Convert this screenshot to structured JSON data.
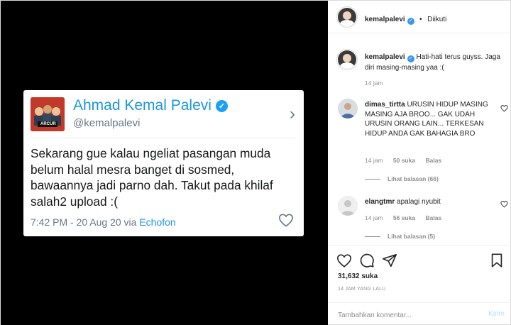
{
  "tweet": {
    "display_name": "Ahmad Kemal Palevi",
    "handle": "@kemalpalevi",
    "avatar_text": "ARCUR",
    "text": "Sekarang gue kalau ngeliat pasangan muda belum halal mesra banget di sosmed, bawaannya jadi parno dah. Takut pada khilaf salah2 upload :(",
    "time": "7:42 PM - 20 Aug 20 via",
    "source": "Echofon"
  },
  "header": {
    "username": "kemalpalevi",
    "separator": "•",
    "follow_status": "Diikuti"
  },
  "caption": {
    "username": "kemalpalevi",
    "text": "Hati-hati terus guyss. Jaga diri masing-masing yaa :(",
    "time": "14 jam"
  },
  "comments": [
    {
      "username": "dimas_tirtta",
      "text": "URUSIN HIDUP MASING MASING AJA BROO... GAK UDAH URUSIN ORANG LAIN... TERKESAN HIDUP ANDA GAK BAHAGIA BRO",
      "time": "14 jam",
      "likes": "50 suka",
      "reply": "Balas",
      "view_replies": "Lihat balasan (66)"
    },
    {
      "username": "elangtmr",
      "text": "apalagi nyubit",
      "time": "14 jam",
      "likes": "56 suka",
      "reply": "Balas",
      "view_replies": "Lihat balasan (5)"
    }
  ],
  "actions": {
    "likes": "31,632 suka",
    "post_time": "14 JAM YANG LALU",
    "comment_placeholder": "Tambahkan komentar...",
    "post_label": "Kirim"
  },
  "icons": {
    "verified": "verified-badge",
    "like": "heart-icon",
    "comment": "comment-icon",
    "share": "share-icon",
    "chevron": "chevron-right-icon"
  },
  "colors": {
    "twitter_blue": "#1b95e0",
    "ig_verified": "#3897f0",
    "muted": "#8e8e8e",
    "post_disabled": "#b2dffc"
  }
}
